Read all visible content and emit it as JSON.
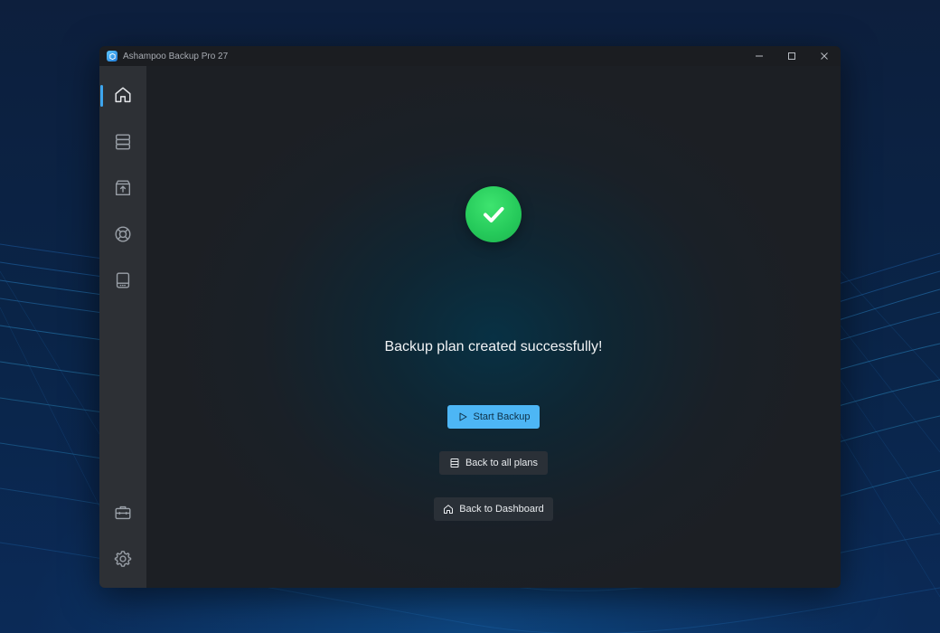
{
  "window": {
    "title": "Ashampoo Backup Pro 27",
    "controls": [
      "minimize-icon",
      "maximize-icon",
      "close-icon"
    ]
  },
  "sidebar": {
    "items": [
      {
        "name": "home",
        "icon": "home-icon",
        "active": true
      },
      {
        "name": "backup-plans",
        "icon": "server-icon",
        "active": false
      },
      {
        "name": "restore",
        "icon": "box-upload-icon",
        "active": false
      },
      {
        "name": "help",
        "icon": "lifebuoy-icon",
        "active": false
      },
      {
        "name": "drives",
        "icon": "drive-icon",
        "active": false
      }
    ],
    "bottom_items": [
      {
        "name": "tools",
        "icon": "toolbox-icon"
      },
      {
        "name": "settings",
        "icon": "gear-icon"
      }
    ]
  },
  "main": {
    "status_icon": "check-circle-icon",
    "message": "Backup plan created successfully!",
    "buttons": {
      "start_backup": "Start Backup",
      "back_to_plans": "Back to all plans",
      "back_to_dashboard": "Back to Dashboard"
    }
  },
  "colors": {
    "accent": "#3da5ee",
    "primary_button": "#4db6f5",
    "success": "#25c95a",
    "sidebar": "#2d3035",
    "window_bg": "#1c1f24"
  }
}
